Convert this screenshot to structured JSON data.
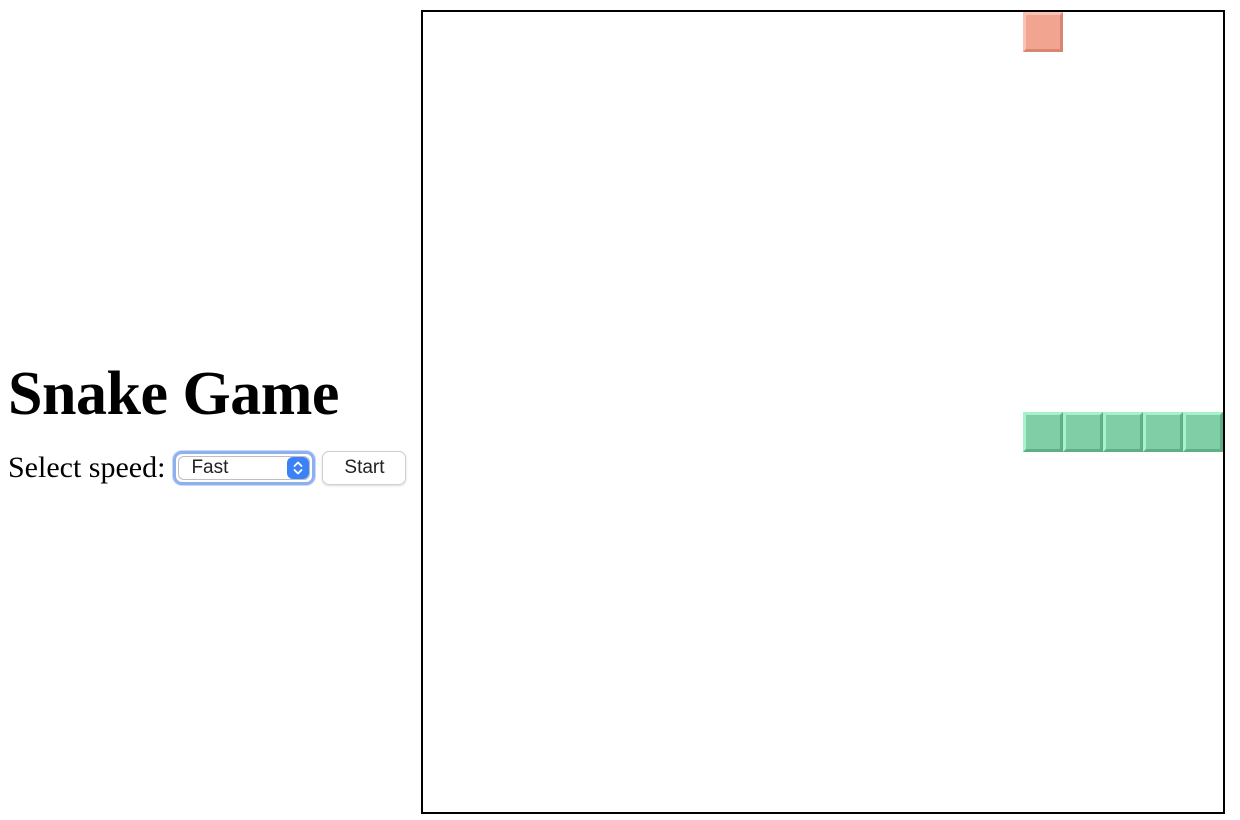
{
  "page": {
    "title": "Snake Game"
  },
  "controls": {
    "speed_label": "Select speed:",
    "speed_selected": "Fast",
    "start_label": "Start"
  },
  "game": {
    "grid_columns": 20,
    "grid_rows": 20,
    "snake": [
      {
        "col": 15,
        "row": 10
      },
      {
        "col": 16,
        "row": 10
      },
      {
        "col": 17,
        "row": 10
      },
      {
        "col": 18,
        "row": 10
      },
      {
        "col": 19,
        "row": 10
      }
    ],
    "food": {
      "col": 15,
      "row": 0
    },
    "colors": {
      "snake": "#7fcea6",
      "food": "#f1a590",
      "board_border": "#000000",
      "select_accent": "#3a82f6"
    }
  }
}
